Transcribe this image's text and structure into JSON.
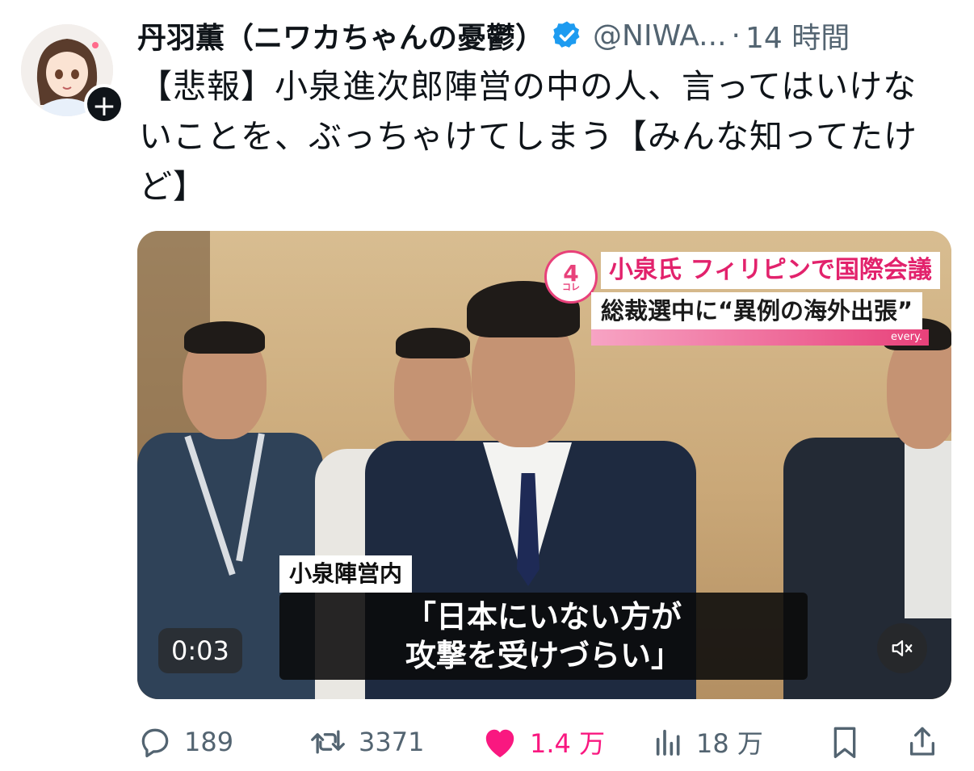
{
  "tweet": {
    "display_name": "丹羽薫（ニワカちゃんの憂鬱）",
    "handle": "@NIWA...",
    "separator": "·",
    "time": "14 時間",
    "text": "【悲報】小泉進次郎陣営の中の人、言ってはいけないことを、ぶっちゃけてしまう【みんな知ってたけど】"
  },
  "avatar": {
    "icon": "anime-girl-avatar",
    "follow_icon": "plus-icon",
    "follow_label": "+"
  },
  "verified": {
    "icon": "verified-badge-icon",
    "color": "#1d9bf0"
  },
  "media": {
    "news_logo": "4",
    "news_logo_sub": "コレ",
    "news_title": "小泉氏 フィリピンで国際会議",
    "news_subtitle": "総裁選中に“異例の海外出張”",
    "news_brand": "every.",
    "caption_tag": "小泉陣営内",
    "caption_line1": "「日本にいない方が",
    "caption_line2": "攻撃を受けづらい」",
    "duration": "0:03",
    "mute_icon": "speaker-muted-icon"
  },
  "actions": {
    "reply_count": "189",
    "repost_count": "3371",
    "like_count": "1.4 万",
    "views_count": "18 万",
    "like_color": "#f91880",
    "muted_color": "#536471"
  }
}
